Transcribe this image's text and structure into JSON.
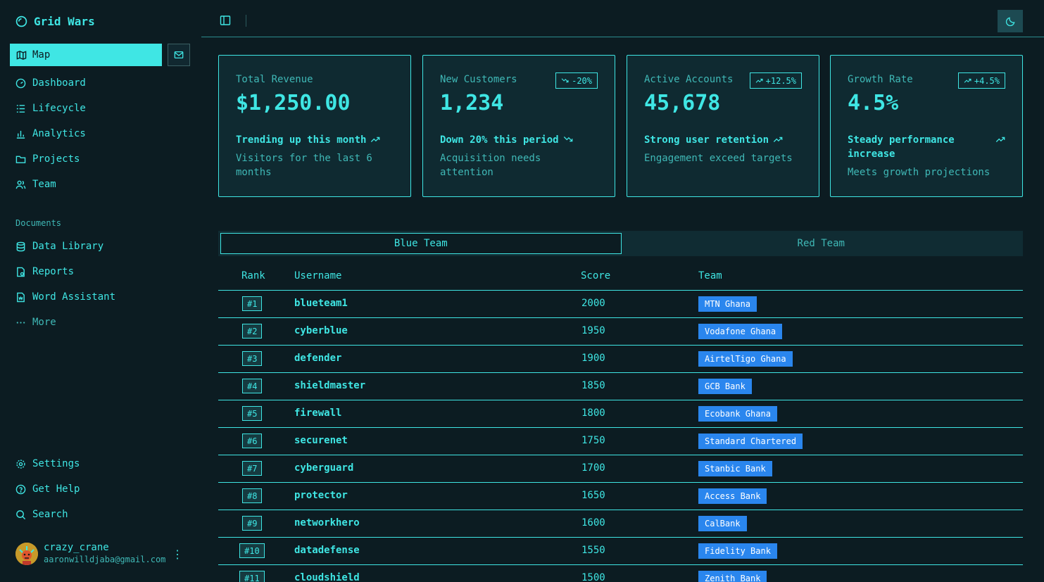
{
  "app": {
    "title": "Grid Wars"
  },
  "sidebar": {
    "primary": {
      "label": "Map"
    },
    "nav": [
      {
        "label": "Dashboard",
        "icon": "gauge-icon"
      },
      {
        "label": "Lifecycle",
        "icon": "list-icon"
      },
      {
        "label": "Analytics",
        "icon": "bar-chart-icon"
      },
      {
        "label": "Projects",
        "icon": "folder-icon"
      },
      {
        "label": "Team",
        "icon": "users-icon"
      }
    ],
    "documents_label": "Documents",
    "documents": [
      {
        "label": "Data Library",
        "icon": "database-icon"
      },
      {
        "label": "Reports",
        "icon": "report-icon"
      },
      {
        "label": "Word Assistant",
        "icon": "document-icon"
      },
      {
        "label": "More",
        "icon": "ellipsis-icon"
      }
    ],
    "bottom": [
      {
        "label": "Settings",
        "icon": "gear-icon"
      },
      {
        "label": "Get Help",
        "icon": "help-icon"
      },
      {
        "label": "Search",
        "icon": "search-icon"
      }
    ],
    "user": {
      "name": "crazy_crane",
      "email": "aaronwilldjaba@gmail.com"
    }
  },
  "cards": [
    {
      "title": "Total Revenue",
      "value": "$1,250.00",
      "badge": "",
      "trend": "Trending up this month",
      "trend_dir": "up",
      "sub": "Visitors for the last 6 months"
    },
    {
      "title": "New Customers",
      "value": "1,234",
      "badge": "-20%",
      "badge_dir": "down",
      "trend": "Down 20% this period",
      "trend_dir": "down",
      "sub": "Acquisition needs attention"
    },
    {
      "title": "Active Accounts",
      "value": "45,678",
      "badge": "+12.5%",
      "badge_dir": "up",
      "trend": "Strong user retention",
      "trend_dir": "up",
      "sub": "Engagement exceed targets"
    },
    {
      "title": "Growth Rate",
      "value": "4.5%",
      "badge": "+4.5%",
      "badge_dir": "up",
      "trend": "Steady performance increase",
      "trend_dir": "up",
      "sub": "Meets growth projections"
    }
  ],
  "tabs": [
    {
      "label": "Blue Team",
      "active": true
    },
    {
      "label": "Red Team",
      "active": false
    }
  ],
  "table": {
    "headers": {
      "rank": "Rank",
      "username": "Username",
      "score": "Score",
      "team": "Team"
    },
    "rows": [
      {
        "rank": "#1",
        "username": "blueteam1",
        "score": "2000",
        "team": "MTN Ghana"
      },
      {
        "rank": "#2",
        "username": "cyberblue",
        "score": "1950",
        "team": "Vodafone Ghana"
      },
      {
        "rank": "#3",
        "username": "defender",
        "score": "1900",
        "team": "AirtelTigo Ghana"
      },
      {
        "rank": "#4",
        "username": "shieldmaster",
        "score": "1850",
        "team": "GCB Bank"
      },
      {
        "rank": "#5",
        "username": "firewall",
        "score": "1800",
        "team": "Ecobank Ghana"
      },
      {
        "rank": "#6",
        "username": "securenet",
        "score": "1750",
        "team": "Standard Chartered"
      },
      {
        "rank": "#7",
        "username": "cyberguard",
        "score": "1700",
        "team": "Stanbic Bank"
      },
      {
        "rank": "#8",
        "username": "protector",
        "score": "1650",
        "team": "Access Bank"
      },
      {
        "rank": "#9",
        "username": "networkhero",
        "score": "1600",
        "team": "CalBank"
      },
      {
        "rank": "#10",
        "username": "datadefense",
        "score": "1550",
        "team": "Fidelity Bank"
      },
      {
        "rank": "#11",
        "username": "cloudshield",
        "score": "1500",
        "team": "Zenith Bank"
      }
    ]
  },
  "colors": {
    "accent": "#3fe6e4",
    "background": "#0c1c22",
    "card": "#0f2a31",
    "team_badge": "#2a86ee"
  }
}
